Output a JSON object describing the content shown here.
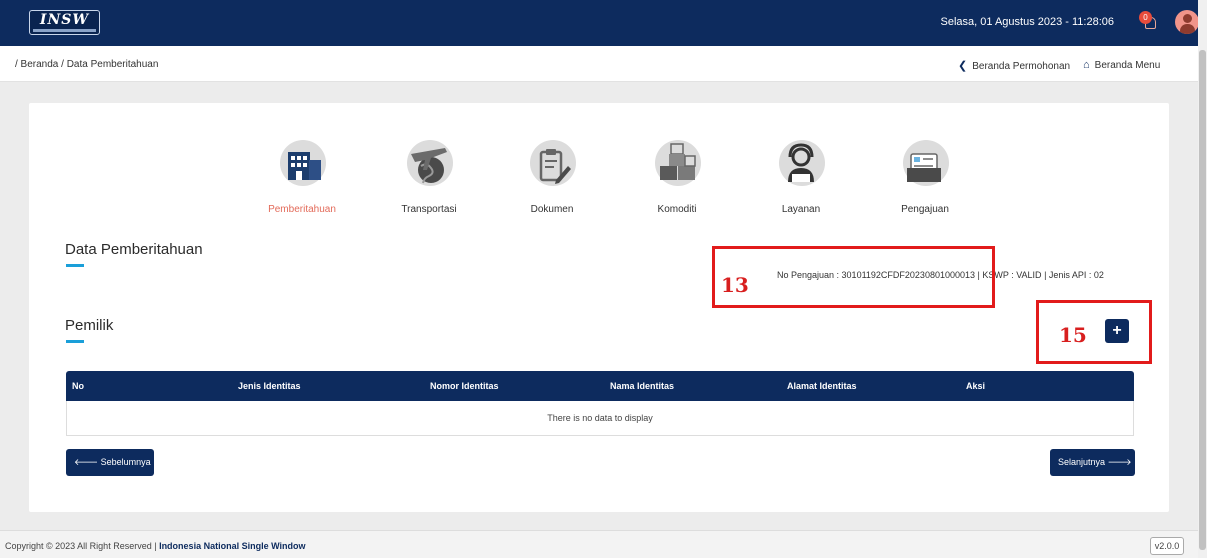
{
  "header": {
    "logo_text": "INSW",
    "datetime": "Selasa, 01 Agustus 2023 - 11:28:06",
    "notification_count": "0"
  },
  "breadcrumb": "/ Beranda / Data Pemberitahuan",
  "nav": {
    "back_label": "Beranda Permohonan",
    "home_label": "Beranda Menu"
  },
  "steps": [
    {
      "label": "Pemberitahuan",
      "icon": "building-icon",
      "active": true
    },
    {
      "label": "Transportasi",
      "icon": "airplane-globe-icon",
      "active": false
    },
    {
      "label": "Dokumen",
      "icon": "document-icon",
      "active": false
    },
    {
      "label": "Komoditi",
      "icon": "boxes-icon",
      "active": false
    },
    {
      "label": "Layanan",
      "icon": "support-agent-icon",
      "active": false
    },
    {
      "label": "Pengajuan",
      "icon": "folder-icon",
      "active": false
    }
  ],
  "data_pemberitahuan": {
    "title": "Data Pemberitahuan",
    "no_pengajuan_text": "No Pengajuan : 30101192CFDF20230801000013",
    "kswp_text": "KSWP : VALID",
    "jenis_api_text": "Jenis API : 02"
  },
  "pemilik": {
    "title": "Pemilik",
    "add_label": "+",
    "columns": [
      "No",
      "Jenis Identitas",
      "Nomor Identitas",
      "Nama Identitas",
      "Alamat Identitas",
      "Aksi"
    ],
    "empty_text": "There is no data to display"
  },
  "annotations": {
    "box_13": "13",
    "box_15": "15"
  },
  "buttons": {
    "prev_label": "Sebelumnya",
    "next_label": "Selanjutnya"
  },
  "footer": {
    "copyright_prefix": "Copyright © 2023 All Right Reserved |",
    "copyright_org": "Indonesia National Single Window",
    "version": "v2.0.0"
  },
  "colors": {
    "primary": "#0d2b5e",
    "accent": "#1a9fd9",
    "active_step": "#e36b5a",
    "annotation": "#e21b1b"
  }
}
